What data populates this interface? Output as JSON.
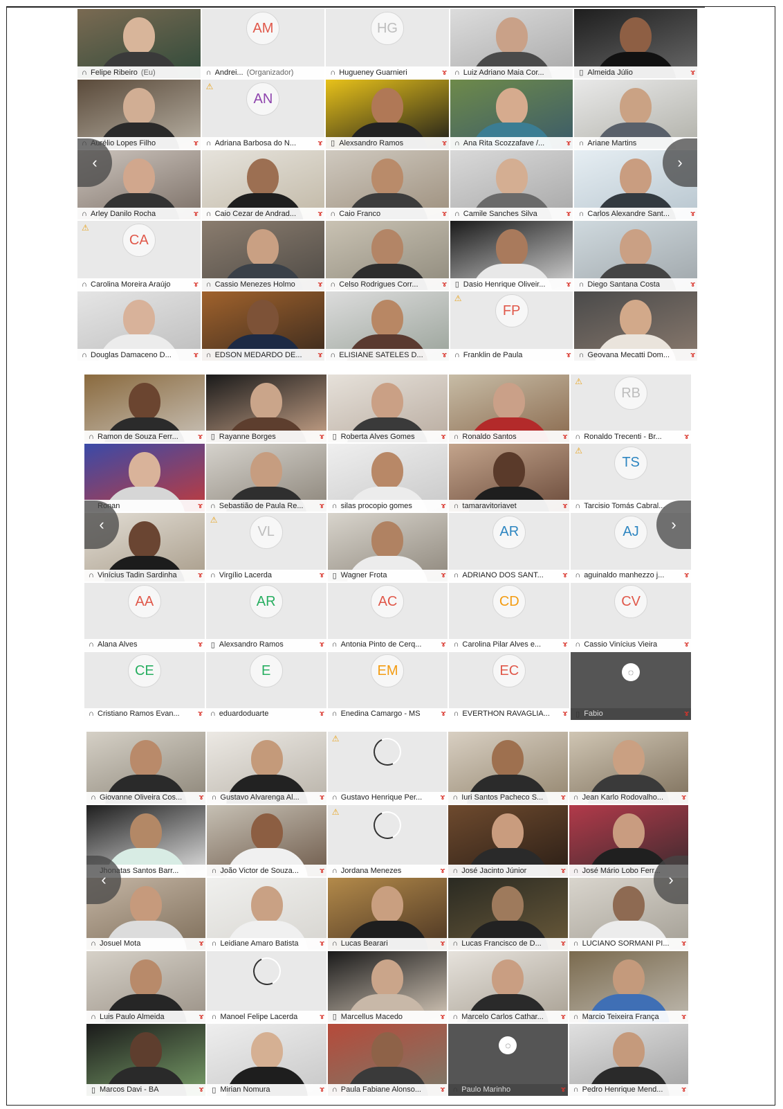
{
  "panels": [
    {
      "id": "panel-1",
      "tiles": [
        {
          "name": "Felipe Ribeiro",
          "suffix": "(Eu)",
          "dev": "headset",
          "muted": false,
          "kind": "video",
          "c1": "#7a6a52",
          "c2": "#2f4a3a",
          "skin": "#d8b59a",
          "shirt": "#3a3a3a"
        },
        {
          "name": "Andrei...",
          "suffix": "(Organizador)",
          "dev": "headset",
          "muted": false,
          "kind": "avatar",
          "initials": "AM",
          "ic": "#e0584a"
        },
        {
          "name": "Hugueney Guarnieri",
          "dev": "headset",
          "muted": true,
          "kind": "avatar",
          "initials": "HG",
          "ic": "#bdbdbd"
        },
        {
          "name": "Luiz Adriano Maia Cor...",
          "dev": "phone-headset",
          "muted": false,
          "kind": "video",
          "c1": "#dcdcdc",
          "c2": "#a9a9a9",
          "skin": "#c9a188",
          "shirt": "#4a4a4a"
        },
        {
          "name": "Almeida Júlio",
          "dev": "phone",
          "muted": true,
          "kind": "video",
          "c1": "#1e1e1e",
          "c2": "#6a6a6a",
          "skin": "#8e5f44",
          "shirt": "#111111"
        },
        {
          "name": "Aurélio Lopes Filho",
          "dev": "headset",
          "muted": true,
          "kind": "video",
          "c1": "#5a4a3a",
          "c2": "#b9b2a5",
          "skin": "#d1ae94",
          "shirt": "#2a2a2a"
        },
        {
          "name": "Adriana Barbosa do N...",
          "dev": "headset",
          "muted": true,
          "kind": "avatar",
          "initials": "AN",
          "ic": "#8e44ad",
          "warn": true
        },
        {
          "name": "Alexsandro Ramos",
          "dev": "phone",
          "muted": true,
          "kind": "video",
          "c1": "#e8c21a",
          "c2": "#1a1a1a",
          "skin": "#b07856",
          "shirt": "#222222"
        },
        {
          "name": "Ana Rita Scozzafave /...",
          "dev": "headset",
          "muted": true,
          "kind": "video",
          "c1": "#6e8a4a",
          "c2": "#3a5a6a",
          "skin": "#d6ab8e",
          "shirt": "#3b7d93"
        },
        {
          "name": "Ariane Martins",
          "dev": "headset",
          "muted": false,
          "kind": "video",
          "c1": "#e9e9e9",
          "c2": "#b0b0a8",
          "skin": "#caa284",
          "shirt": "#59606a"
        },
        {
          "name": "Arley Danilo Rocha",
          "dev": "headset",
          "muted": true,
          "kind": "video",
          "c1": "#ccc4bd",
          "c2": "#7b6f66",
          "skin": "#d1a78d",
          "shirt": "#333333"
        },
        {
          "name": "Caio Cezar de Andrad...",
          "dev": "headset",
          "muted": true,
          "kind": "video",
          "c1": "#e6e3dc",
          "c2": "#c1b8a6",
          "skin": "#9c6f52",
          "shirt": "#1e1e1e"
        },
        {
          "name": "Caio Franco",
          "dev": "headset",
          "muted": true,
          "kind": "video",
          "c1": "#cfc9bf",
          "c2": "#9d8f7d",
          "skin": "#b98b6a",
          "shirt": "#3c3c3c"
        },
        {
          "name": "Camile Sanches Silva",
          "dev": "headset",
          "muted": true,
          "kind": "video",
          "c1": "#d9d9d9",
          "c2": "#a7a7a7",
          "skin": "#d4ae92",
          "shirt": "#6a6a6a"
        },
        {
          "name": "Carlos Alexandre Sant...",
          "dev": "headset",
          "muted": true,
          "kind": "video",
          "c1": "#e6eef3",
          "c2": "#b7c5ce",
          "skin": "#c99d80",
          "shirt": "#333a40"
        },
        {
          "name": "Carolina Moreira Araújo",
          "dev": "headset",
          "muted": true,
          "kind": "avatar",
          "initials": "CA",
          "ic": "#e0584a",
          "warn": true
        },
        {
          "name": "Cassio Menezes Holmo",
          "dev": "headset",
          "muted": true,
          "kind": "video",
          "c1": "#8a7c6e",
          "c2": "#4e4a45",
          "skin": "#c9a083",
          "shirt": "#3a4048"
        },
        {
          "name": "Celso Rodrigues Corr...",
          "dev": "headset",
          "muted": true,
          "kind": "video",
          "c1": "#c9c2b3",
          "c2": "#8f8a7c",
          "skin": "#b38566",
          "shirt": "#2d2d2d"
        },
        {
          "name": "Dasio Henrique Oliveir...",
          "dev": "phone",
          "muted": true,
          "kind": "video",
          "c1": "#1a1a1a",
          "c2": "#d8d8d8",
          "skin": "#a97a5c",
          "shirt": "#e8e8e8"
        },
        {
          "name": "Diego Santana Costa",
          "dev": "headset",
          "muted": true,
          "kind": "video",
          "c1": "#cfd9de",
          "c2": "#9fa6aa",
          "skin": "#caa084",
          "shirt": "#444444"
        },
        {
          "name": "Douglas Damaceno D...",
          "dev": "headset",
          "muted": true,
          "kind": "video",
          "c1": "#e5e5e5",
          "c2": "#bdbdbd",
          "skin": "#d8b29a",
          "shirt": "#ececec"
        },
        {
          "name": "EDSON MEDARDO DE...",
          "dev": "headset",
          "muted": true,
          "kind": "video",
          "c1": "#a0622c",
          "c2": "#3a2a1e",
          "skin": "#7d5237",
          "shirt": "#1d2a44"
        },
        {
          "name": "ELISIANE SATELES D...",
          "dev": "headset",
          "muted": true,
          "kind": "video",
          "c1": "#dcdcdc",
          "c2": "#9aa39a",
          "skin": "#b88764",
          "shirt": "#5a3a30"
        },
        {
          "name": "Franklin de Paula",
          "dev": "headset",
          "muted": true,
          "kind": "avatar",
          "initials": "FP",
          "ic": "#e0584a",
          "warn": true
        },
        {
          "name": "Geovana Mecatti Dom...",
          "dev": "headset",
          "muted": true,
          "kind": "video",
          "c1": "#4a4a4a",
          "c2": "#8a7a6e",
          "skin": "#d2a98a",
          "shirt": "#eae4dc"
        }
      ]
    },
    {
      "id": "panel-2",
      "tiles": [
        {
          "name": "Ramon de Souza Ferr...",
          "dev": "headset",
          "muted": true,
          "kind": "video",
          "c1": "#8a6a3e",
          "c2": "#c9c2b8",
          "skin": "#6b4530",
          "shirt": "#2b2b2b"
        },
        {
          "name": "Rayanne Borges",
          "dev": "phone",
          "muted": true,
          "kind": "video",
          "c1": "#1a1a1a",
          "c2": "#caa58a",
          "skin": "#caa58a",
          "shirt": "#5d3e2e"
        },
        {
          "name": "Roberta Alves Gomes",
          "dev": "phone",
          "muted": true,
          "kind": "video",
          "c1": "#e6e1da",
          "c2": "#b9aca0",
          "skin": "#caa085",
          "shirt": "#3a3a3a"
        },
        {
          "name": "Ronaldo Santos",
          "dev": "headset",
          "muted": true,
          "kind": "video",
          "c1": "#c7bca6",
          "c2": "#8a6a4e",
          "skin": "#caa088",
          "shirt": "#b32a2a"
        },
        {
          "name": "Ronaldo Trecenti - Br...",
          "dev": "headset",
          "muted": true,
          "kind": "avatar",
          "initials": "RB",
          "ic": "#bdbdbd",
          "warn": true
        },
        {
          "name": "Ronan",
          "dev": "none",
          "muted": true,
          "kind": "video",
          "c1": "#3a4aa8",
          "c2": "#c23b3b",
          "skin": "#d9b39a",
          "shirt": "#d6d6d6"
        },
        {
          "name": "Sebastião de Paula Re...",
          "dev": "headset",
          "muted": true,
          "kind": "video",
          "c1": "#d5d2cc",
          "c2": "#8c857a",
          "skin": "#c69d80",
          "shirt": "#2f2f2f"
        },
        {
          "name": "silas procopio gomes",
          "dev": "headset",
          "muted": true,
          "kind": "video",
          "c1": "#efefef",
          "c2": "#c8c8c8",
          "skin": "#b88867",
          "shirt": "#ececec"
        },
        {
          "name": "tamaravitoriavet",
          "dev": "headset",
          "muted": true,
          "kind": "video",
          "c1": "#c3a48c",
          "c2": "#6a4a3a",
          "skin": "#5a3a2a",
          "shirt": "#1e1e1e"
        },
        {
          "name": "Tarcisio Tomás Cabral...",
          "dev": "headset",
          "muted": false,
          "kind": "avatar",
          "initials": "TS",
          "ic": "#2e86c1",
          "warn": true
        },
        {
          "name": "Vinícius Tadin Sardinha",
          "dev": "headset",
          "muted": true,
          "kind": "video",
          "c1": "#e2ddd4",
          "c2": "#a89c8a",
          "skin": "#6a4532",
          "shirt": "#1c1c1c"
        },
        {
          "name": "Virgílio Lacerda",
          "dev": "headset",
          "muted": true,
          "kind": "avatar",
          "initials": "VL",
          "ic": "#bdbdbd",
          "warn": true
        },
        {
          "name": "Wagner Frota",
          "dev": "phone",
          "muted": true,
          "kind": "video",
          "c1": "#d8d4cc",
          "c2": "#8e877c",
          "skin": "#b08262",
          "shirt": "#ececec"
        },
        {
          "name": "ADRIANO DOS SANT...",
          "dev": "headset",
          "muted": true,
          "kind": "avatar",
          "initials": "AR",
          "ic": "#2e86c1"
        },
        {
          "name": "aguinaldo manhezzo j...",
          "dev": "headset",
          "muted": true,
          "kind": "avatar",
          "initials": "AJ",
          "ic": "#2e86c1"
        },
        {
          "name": "Alana Alves",
          "dev": "headset",
          "muted": true,
          "kind": "avatar",
          "initials": "AA",
          "ic": "#e0584a"
        },
        {
          "name": "Alexsandro Ramos",
          "dev": "phone",
          "muted": true,
          "kind": "avatar",
          "initials": "AR",
          "ic": "#27ae60"
        },
        {
          "name": "Antonia Pinto de Cerq...",
          "dev": "headset",
          "muted": true,
          "kind": "avatar",
          "initials": "AC",
          "ic": "#e0584a"
        },
        {
          "name": "Carolina Pilar Alves e...",
          "dev": "headset",
          "muted": true,
          "kind": "avatar",
          "initials": "CD",
          "ic": "#f39c12"
        },
        {
          "name": "Cassio Vinícius Vieira",
          "dev": "headset",
          "muted": true,
          "kind": "avatar",
          "initials": "CV",
          "ic": "#e0584a"
        },
        {
          "name": "Cristiano Ramos Evan...",
          "dev": "headset",
          "muted": true,
          "kind": "avatar",
          "initials": "CE",
          "ic": "#27ae60"
        },
        {
          "name": "eduardoduarte",
          "dev": "headset",
          "muted": true,
          "kind": "avatar",
          "initials": "E",
          "ic": "#27ae60"
        },
        {
          "name": "Enedina Camargo - MS",
          "dev": "headset",
          "muted": true,
          "kind": "avatar",
          "initials": "EM",
          "ic": "#f39c12"
        },
        {
          "name": "EVERTHON RAVAGLIA...",
          "dev": "headset",
          "muted": true,
          "kind": "avatar",
          "initials": "EC",
          "ic": "#e0584a"
        },
        {
          "name": "Fabio",
          "dev": "phone",
          "muted": true,
          "kind": "dark"
        }
      ]
    },
    {
      "id": "panel-3",
      "tiles": [
        {
          "name": "Giovanne Oliveira Cos...",
          "dev": "headset",
          "muted": true,
          "kind": "video",
          "c1": "#d5d0c6",
          "c2": "#8d8679",
          "skin": "#b98a6a",
          "shirt": "#2a2a2a"
        },
        {
          "name": "Gustavo Alvarenga Al...",
          "dev": "headset",
          "muted": true,
          "kind": "video",
          "c1": "#ece9e4",
          "c2": "#b9b3a9",
          "skin": "#c49a7a",
          "shirt": "#222222"
        },
        {
          "name": "Gustavo Henrique Per...",
          "dev": "headset",
          "muted": true,
          "kind": "spinner",
          "warn": true
        },
        {
          "name": "Iuri Santos Pacheco S...",
          "dev": "headset",
          "muted": true,
          "kind": "video",
          "c1": "#d8cfc2",
          "c2": "#94866f",
          "skin": "#9e704f",
          "shirt": "#2b2b2b"
        },
        {
          "name": "Jean Karlo Rodovalho...",
          "dev": "headset",
          "muted": true,
          "kind": "video",
          "c1": "#cfc5b3",
          "c2": "#7e705c",
          "skin": "#caa082",
          "shirt": "#3a3a3a"
        },
        {
          "name": "Jhonatas Santos Barr...",
          "dev": "none",
          "muted": false,
          "kind": "video",
          "c1": "#1e1e1e",
          "c2": "#e4e4e4",
          "skin": "#b38866",
          "shirt": "#d8ece4"
        },
        {
          "name": "João Victor de Souza...",
          "dev": "headset",
          "muted": true,
          "kind": "video",
          "c1": "#c6c0b4",
          "c2": "#6e5a4a",
          "skin": "#8c5e42",
          "shirt": "#f0f0f0"
        },
        {
          "name": "Jordana Menezes",
          "dev": "headset",
          "muted": true,
          "kind": "spinner",
          "warn": true
        },
        {
          "name": "José Jacinto Júnior",
          "dev": "headset",
          "muted": true,
          "kind": "video",
          "c1": "#6e4a2e",
          "c2": "#2a1e16",
          "skin": "#c99c7e",
          "shirt": "#2a2a2a"
        },
        {
          "name": "José Mário Lobo Ferr...",
          "dev": "headset",
          "muted": false,
          "kind": "video",
          "c1": "#b23a4a",
          "c2": "#3a2a2e",
          "skin": "#c99c80",
          "shirt": "#202020"
        },
        {
          "name": "Josuel Mota",
          "dev": "headset",
          "muted": true,
          "kind": "video",
          "c1": "#c4b5a4",
          "c2": "#7e6e5a",
          "skin": "#c69a7c",
          "shirt": "#dcdcdc"
        },
        {
          "name": "Leidiane Amaro Batista",
          "dev": "headset",
          "muted": true,
          "kind": "video",
          "c1": "#f0f0ee",
          "c2": "#d6d4cf",
          "skin": "#c9a184",
          "shirt": "#f0f0f0"
        },
        {
          "name": "Lucas Bearari",
          "dev": "headset",
          "muted": true,
          "kind": "video",
          "c1": "#b38a4a",
          "c2": "#4a3422",
          "skin": "#c99f80",
          "shirt": "#1e1e1e"
        },
        {
          "name": "Lucas Francisco de D...",
          "dev": "headset",
          "muted": true,
          "kind": "video",
          "c1": "#2a2a22",
          "c2": "#6a5a3a",
          "skin": "#9e7a5c",
          "shirt": "#222222"
        },
        {
          "name": "LUCIANO SORMANI PI...",
          "dev": "headset",
          "muted": true,
          "kind": "video",
          "c1": "#d9d5cd",
          "c2": "#a39e94",
          "skin": "#8e6a52",
          "shirt": "#ececec"
        },
        {
          "name": "Luis Paulo Almeida",
          "dev": "headset",
          "muted": true,
          "kind": "video",
          "c1": "#d6d1c8",
          "c2": "#9a9186",
          "skin": "#b88a6a",
          "shirt": "#262626"
        },
        {
          "name": "Manoel Felipe Lacerda",
          "dev": "headset",
          "muted": true,
          "kind": "spinner"
        },
        {
          "name": "Marcellus Macedo",
          "dev": "phone",
          "muted": true,
          "kind": "video",
          "c1": "#1a1a1a",
          "c2": "#d8cbbb",
          "skin": "#caa58a",
          "shirt": "#c8b8a8"
        },
        {
          "name": "Marcelo Carlos Cathar...",
          "dev": "headset",
          "muted": true,
          "kind": "video",
          "c1": "#e6e2dc",
          "c2": "#a8a093",
          "skin": "#c99e82",
          "shirt": "#2a2a2a"
        },
        {
          "name": "Marcio Teixeira França",
          "dev": "headset",
          "muted": true,
          "kind": "video",
          "c1": "#7a6a4e",
          "c2": "#bfbab0",
          "skin": "#c49a7c",
          "shirt": "#3f6fb5"
        },
        {
          "name": "Marcos Davi - BA",
          "dev": "phone",
          "muted": true,
          "kind": "video",
          "c1": "#1a1a1a",
          "c2": "#7aa06a",
          "skin": "#5e3e2e",
          "shirt": "#2a2a2a"
        },
        {
          "name": "Mirian Nomura",
          "dev": "phone",
          "muted": true,
          "kind": "video",
          "c1": "#eeeeee",
          "c2": "#c7c7c7",
          "skin": "#d5b093",
          "shirt": "#1e1e1e"
        },
        {
          "name": "Paula Fabiane Alonso...",
          "dev": "headset",
          "muted": true,
          "kind": "video",
          "c1": "#b64a3a",
          "c2": "#7a7a6a",
          "skin": "#8e6248",
          "shirt": "#3a3a3a"
        },
        {
          "name": "Paulo Marinho",
          "dev": "headset",
          "muted": true,
          "kind": "dark"
        },
        {
          "name": "Pedro Henrique Mend...",
          "dev": "headset",
          "muted": true,
          "kind": "video",
          "c1": "#e0e0e0",
          "c2": "#a0a0a0",
          "skin": "#c59a7c",
          "shirt": "#2a2a2a"
        }
      ]
    }
  ],
  "nav": {
    "left_glyph": "‹",
    "right_glyph": "›"
  },
  "icons": {
    "headset": "headphones-icon",
    "phone": "phone-icon",
    "muted": "microphone-muted-icon",
    "warning": "warning-icon"
  },
  "colors": {
    "mute": "#d9342b",
    "warning": "#e8a21a",
    "caption_bg": "#ffffff",
    "dark_tile": "#555555"
  }
}
